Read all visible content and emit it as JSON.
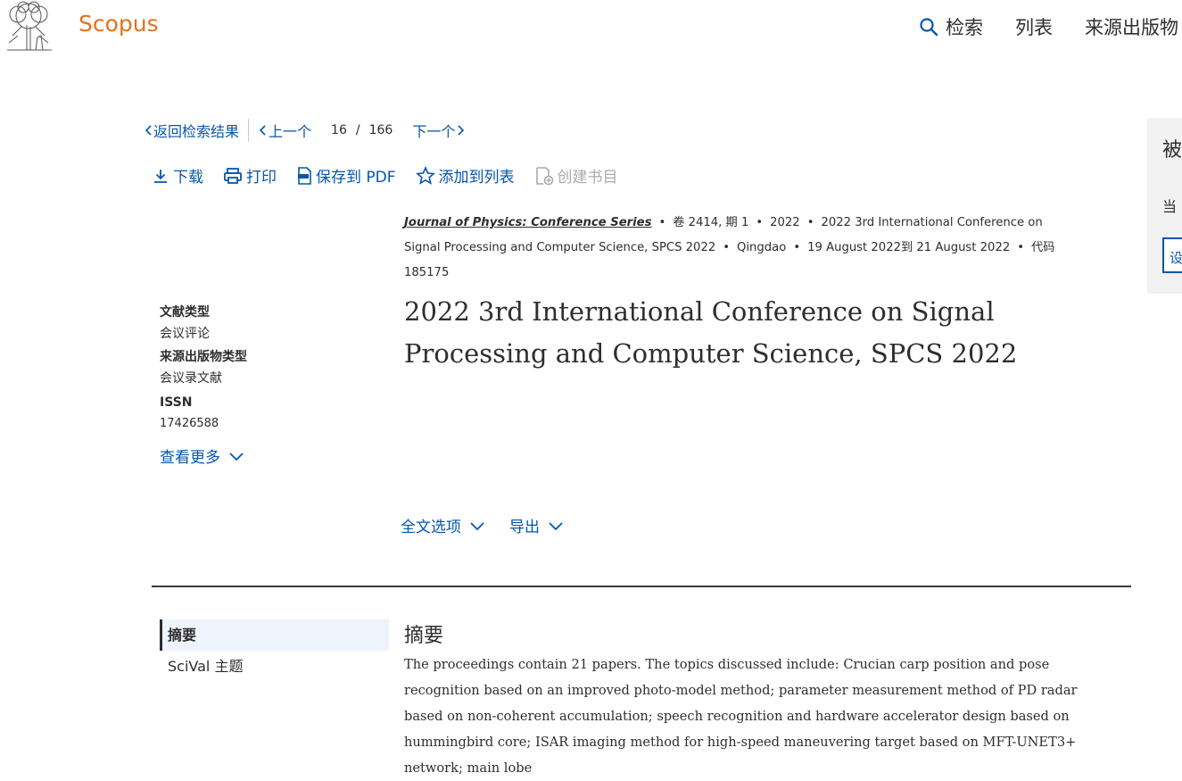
{
  "header": {
    "brand": "Scopus",
    "nav": [
      {
        "icon": "search-icon",
        "label": "检索"
      },
      {
        "label": "列表"
      },
      {
        "label": "来源出版物"
      }
    ]
  },
  "record_nav": {
    "back": "返回检索结果",
    "prev": "上一个",
    "current": "16",
    "slash": "/",
    "total": "166",
    "next": "下一个"
  },
  "toolbar": {
    "download": "下载",
    "print": "打印",
    "save_pdf": "保存到 PDF",
    "add_list": "添加到列表",
    "create_bib": "创建书目"
  },
  "source": {
    "journal": "Journal of Physics: Conference Series",
    "volume": "卷 2414, 期 1",
    "year": "2022",
    "conference": "2022 3rd International Conference on Signal Processing and Computer Science, SPCS 2022",
    "location": "Qingdao",
    "dates": "19 August 2022到 21 August 2022",
    "code": "代码 185175"
  },
  "meta": {
    "doc_type_label": "文献类型",
    "doc_type": "会议评论",
    "source_type_label": "来源出版物类型",
    "source_type": "会议录文献",
    "issn_label": "ISSN",
    "issn": "17426588",
    "more": "查看更多"
  },
  "title": "2022 3rd International Conference on Signal Processing and Computer Science, SPCS 2022",
  "options": {
    "fulltext": "全文选项",
    "export": "导出"
  },
  "sidenav": {
    "items": [
      {
        "label": "摘要"
      },
      {
        "label": "SciVal 主题"
      }
    ]
  },
  "abstract": {
    "heading": "摘要",
    "text": "The proceedings contain 21 papers. The topics discussed include: Crucian carp position and pose recognition based on an improved photo-model method; parameter measurement method of PD radar based on non-coherent accumulation; speech recognition and hardware accelerator design based on hummingbird core; ISAR imaging method for high-speed maneuvering target based on MFT-UNET3+ network; main lobe"
  },
  "right_panel": {
    "heading": "被",
    "text": "当",
    "button": "设"
  },
  "colors": {
    "brand": "#e9711c",
    "link": "#0656ad"
  }
}
